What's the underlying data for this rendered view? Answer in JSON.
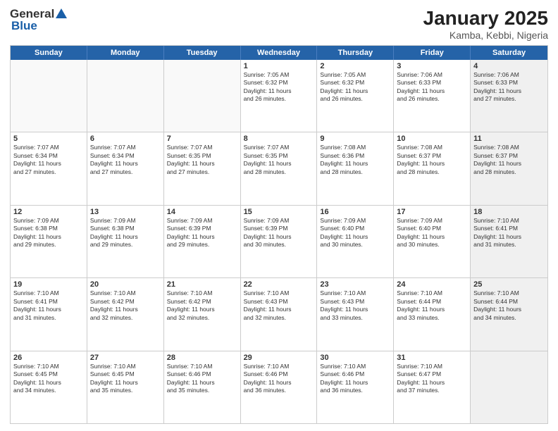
{
  "logo": {
    "general": "General",
    "blue": "Blue"
  },
  "title": {
    "month_year": "January 2025",
    "location": "Kamba, Kebbi, Nigeria"
  },
  "days_header": [
    "Sunday",
    "Monday",
    "Tuesday",
    "Wednesday",
    "Thursday",
    "Friday",
    "Saturday"
  ],
  "weeks": [
    [
      {
        "day": "",
        "sunrise": "",
        "sunset": "",
        "daylight": "",
        "empty": true
      },
      {
        "day": "",
        "sunrise": "",
        "sunset": "",
        "daylight": "",
        "empty": true
      },
      {
        "day": "",
        "sunrise": "",
        "sunset": "",
        "daylight": "",
        "empty": true
      },
      {
        "day": "1",
        "sunrise": "Sunrise: 7:05 AM",
        "sunset": "Sunset: 6:32 PM",
        "daylight1": "Daylight: 11 hours",
        "daylight2": "and 26 minutes.",
        "empty": false
      },
      {
        "day": "2",
        "sunrise": "Sunrise: 7:05 AM",
        "sunset": "Sunset: 6:32 PM",
        "daylight1": "Daylight: 11 hours",
        "daylight2": "and 26 minutes.",
        "empty": false
      },
      {
        "day": "3",
        "sunrise": "Sunrise: 7:06 AM",
        "sunset": "Sunset: 6:33 PM",
        "daylight1": "Daylight: 11 hours",
        "daylight2": "and 26 minutes.",
        "empty": false
      },
      {
        "day": "4",
        "sunrise": "Sunrise: 7:06 AM",
        "sunset": "Sunset: 6:33 PM",
        "daylight1": "Daylight: 11 hours",
        "daylight2": "and 27 minutes.",
        "empty": false,
        "shaded": true
      }
    ],
    [
      {
        "day": "5",
        "sunrise": "Sunrise: 7:07 AM",
        "sunset": "Sunset: 6:34 PM",
        "daylight1": "Daylight: 11 hours",
        "daylight2": "and 27 minutes.",
        "empty": false
      },
      {
        "day": "6",
        "sunrise": "Sunrise: 7:07 AM",
        "sunset": "Sunset: 6:34 PM",
        "daylight1": "Daylight: 11 hours",
        "daylight2": "and 27 minutes.",
        "empty": false
      },
      {
        "day": "7",
        "sunrise": "Sunrise: 7:07 AM",
        "sunset": "Sunset: 6:35 PM",
        "daylight1": "Daylight: 11 hours",
        "daylight2": "and 27 minutes.",
        "empty": false
      },
      {
        "day": "8",
        "sunrise": "Sunrise: 7:07 AM",
        "sunset": "Sunset: 6:35 PM",
        "daylight1": "Daylight: 11 hours",
        "daylight2": "and 28 minutes.",
        "empty": false
      },
      {
        "day": "9",
        "sunrise": "Sunrise: 7:08 AM",
        "sunset": "Sunset: 6:36 PM",
        "daylight1": "Daylight: 11 hours",
        "daylight2": "and 28 minutes.",
        "empty": false
      },
      {
        "day": "10",
        "sunrise": "Sunrise: 7:08 AM",
        "sunset": "Sunset: 6:37 PM",
        "daylight1": "Daylight: 11 hours",
        "daylight2": "and 28 minutes.",
        "empty": false
      },
      {
        "day": "11",
        "sunrise": "Sunrise: 7:08 AM",
        "sunset": "Sunset: 6:37 PM",
        "daylight1": "Daylight: 11 hours",
        "daylight2": "and 28 minutes.",
        "empty": false,
        "shaded": true
      }
    ],
    [
      {
        "day": "12",
        "sunrise": "Sunrise: 7:09 AM",
        "sunset": "Sunset: 6:38 PM",
        "daylight1": "Daylight: 11 hours",
        "daylight2": "and 29 minutes.",
        "empty": false
      },
      {
        "day": "13",
        "sunrise": "Sunrise: 7:09 AM",
        "sunset": "Sunset: 6:38 PM",
        "daylight1": "Daylight: 11 hours",
        "daylight2": "and 29 minutes.",
        "empty": false
      },
      {
        "day": "14",
        "sunrise": "Sunrise: 7:09 AM",
        "sunset": "Sunset: 6:39 PM",
        "daylight1": "Daylight: 11 hours",
        "daylight2": "and 29 minutes.",
        "empty": false
      },
      {
        "day": "15",
        "sunrise": "Sunrise: 7:09 AM",
        "sunset": "Sunset: 6:39 PM",
        "daylight1": "Daylight: 11 hours",
        "daylight2": "and 30 minutes.",
        "empty": false
      },
      {
        "day": "16",
        "sunrise": "Sunrise: 7:09 AM",
        "sunset": "Sunset: 6:40 PM",
        "daylight1": "Daylight: 11 hours",
        "daylight2": "and 30 minutes.",
        "empty": false
      },
      {
        "day": "17",
        "sunrise": "Sunrise: 7:09 AM",
        "sunset": "Sunset: 6:40 PM",
        "daylight1": "Daylight: 11 hours",
        "daylight2": "and 30 minutes.",
        "empty": false
      },
      {
        "day": "18",
        "sunrise": "Sunrise: 7:10 AM",
        "sunset": "Sunset: 6:41 PM",
        "daylight1": "Daylight: 11 hours",
        "daylight2": "and 31 minutes.",
        "empty": false,
        "shaded": true
      }
    ],
    [
      {
        "day": "19",
        "sunrise": "Sunrise: 7:10 AM",
        "sunset": "Sunset: 6:41 PM",
        "daylight1": "Daylight: 11 hours",
        "daylight2": "and 31 minutes.",
        "empty": false
      },
      {
        "day": "20",
        "sunrise": "Sunrise: 7:10 AM",
        "sunset": "Sunset: 6:42 PM",
        "daylight1": "Daylight: 11 hours",
        "daylight2": "and 32 minutes.",
        "empty": false
      },
      {
        "day": "21",
        "sunrise": "Sunrise: 7:10 AM",
        "sunset": "Sunset: 6:42 PM",
        "daylight1": "Daylight: 11 hours",
        "daylight2": "and 32 minutes.",
        "empty": false
      },
      {
        "day": "22",
        "sunrise": "Sunrise: 7:10 AM",
        "sunset": "Sunset: 6:43 PM",
        "daylight1": "Daylight: 11 hours",
        "daylight2": "and 32 minutes.",
        "empty": false
      },
      {
        "day": "23",
        "sunrise": "Sunrise: 7:10 AM",
        "sunset": "Sunset: 6:43 PM",
        "daylight1": "Daylight: 11 hours",
        "daylight2": "and 33 minutes.",
        "empty": false
      },
      {
        "day": "24",
        "sunrise": "Sunrise: 7:10 AM",
        "sunset": "Sunset: 6:44 PM",
        "daylight1": "Daylight: 11 hours",
        "daylight2": "and 33 minutes.",
        "empty": false
      },
      {
        "day": "25",
        "sunrise": "Sunrise: 7:10 AM",
        "sunset": "Sunset: 6:44 PM",
        "daylight1": "Daylight: 11 hours",
        "daylight2": "and 34 minutes.",
        "empty": false,
        "shaded": true
      }
    ],
    [
      {
        "day": "26",
        "sunrise": "Sunrise: 7:10 AM",
        "sunset": "Sunset: 6:45 PM",
        "daylight1": "Daylight: 11 hours",
        "daylight2": "and 34 minutes.",
        "empty": false
      },
      {
        "day": "27",
        "sunrise": "Sunrise: 7:10 AM",
        "sunset": "Sunset: 6:45 PM",
        "daylight1": "Daylight: 11 hours",
        "daylight2": "and 35 minutes.",
        "empty": false
      },
      {
        "day": "28",
        "sunrise": "Sunrise: 7:10 AM",
        "sunset": "Sunset: 6:46 PM",
        "daylight1": "Daylight: 11 hours",
        "daylight2": "and 35 minutes.",
        "empty": false
      },
      {
        "day": "29",
        "sunrise": "Sunrise: 7:10 AM",
        "sunset": "Sunset: 6:46 PM",
        "daylight1": "Daylight: 11 hours",
        "daylight2": "and 36 minutes.",
        "empty": false
      },
      {
        "day": "30",
        "sunrise": "Sunrise: 7:10 AM",
        "sunset": "Sunset: 6:46 PM",
        "daylight1": "Daylight: 11 hours",
        "daylight2": "and 36 minutes.",
        "empty": false
      },
      {
        "day": "31",
        "sunrise": "Sunrise: 7:10 AM",
        "sunset": "Sunset: 6:47 PM",
        "daylight1": "Daylight: 11 hours",
        "daylight2": "and 37 minutes.",
        "empty": false
      },
      {
        "day": "",
        "sunrise": "",
        "sunset": "",
        "daylight1": "",
        "daylight2": "",
        "empty": true,
        "shaded": true
      }
    ]
  ]
}
